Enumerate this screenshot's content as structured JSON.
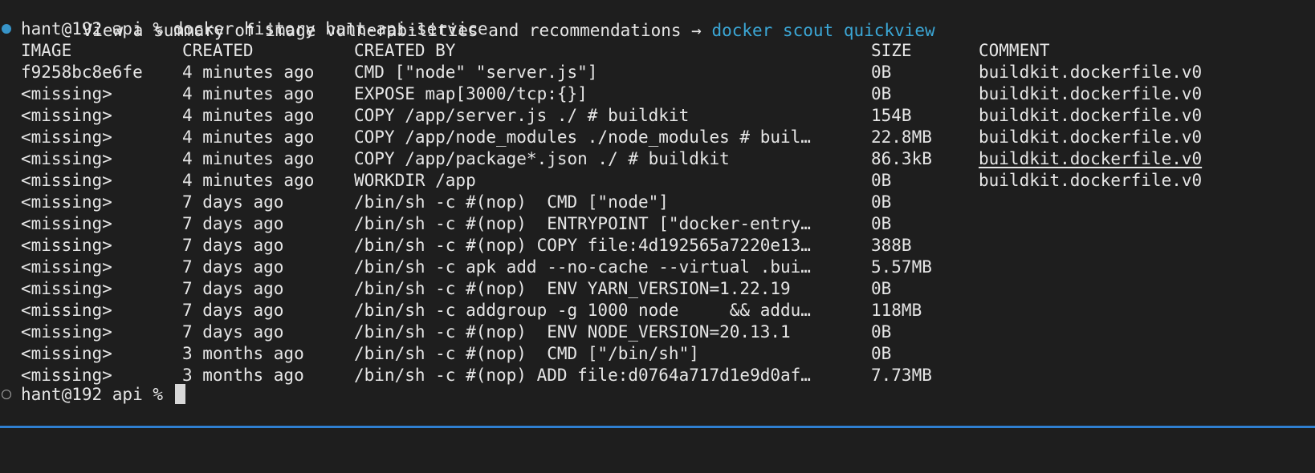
{
  "hint": {
    "text": "View a summary of image vulnerabilities and recommendations → ",
    "command": "docker scout quickview"
  },
  "prompt": {
    "text": "hant@192 api % ",
    "command": "docker history hant-api-service"
  },
  "table": {
    "headers": [
      "IMAGE",
      "CREATED",
      "CREATED BY",
      "SIZE",
      "COMMENT"
    ],
    "rows": [
      [
        "f9258bc8e6fe",
        "4 minutes ago",
        "CMD [\"node\" \"server.js\"]",
        "0B",
        "buildkit.dockerfile.v0"
      ],
      [
        "<missing>",
        "4 minutes ago",
        "EXPOSE map[3000/tcp:{}]",
        "0B",
        "buildkit.dockerfile.v0"
      ],
      [
        "<missing>",
        "4 minutes ago",
        "COPY /app/server.js ./ # buildkit",
        "154B",
        "buildkit.dockerfile.v0"
      ],
      [
        "<missing>",
        "4 minutes ago",
        "COPY /app/node_modules ./node_modules # buil…",
        "22.8MB",
        "buildkit.dockerfile.v0"
      ],
      [
        "<missing>",
        "4 minutes ago",
        "COPY /app/package*.json ./ # buildkit",
        "86.3kB",
        "buildkit.dockerfile.v0"
      ],
      [
        "<missing>",
        "4 minutes ago",
        "WORKDIR /app",
        "0B",
        "buildkit.dockerfile.v0"
      ],
      [
        "<missing>",
        "7 days ago",
        "/bin/sh -c #(nop)  CMD [\"node\"]",
        "0B",
        ""
      ],
      [
        "<missing>",
        "7 days ago",
        "/bin/sh -c #(nop)  ENTRYPOINT [\"docker-entry…",
        "0B",
        ""
      ],
      [
        "<missing>",
        "7 days ago",
        "/bin/sh -c #(nop) COPY file:4d192565a7220e13…",
        "388B",
        ""
      ],
      [
        "<missing>",
        "7 days ago",
        "/bin/sh -c apk add --no-cache --virtual .bui…",
        "5.57MB",
        ""
      ],
      [
        "<missing>",
        "7 days ago",
        "/bin/sh -c #(nop)  ENV YARN_VERSION=1.22.19",
        "0B",
        ""
      ],
      [
        "<missing>",
        "7 days ago",
        "/bin/sh -c addgroup -g 1000 node     && addu…",
        "118MB",
        ""
      ],
      [
        "<missing>",
        "7 days ago",
        "/bin/sh -c #(nop)  ENV NODE_VERSION=20.13.1",
        "0B",
        ""
      ],
      [
        "<missing>",
        "3 months ago",
        "/bin/sh -c #(nop)  CMD [\"/bin/sh\"]",
        "0B",
        ""
      ],
      [
        "<missing>",
        "3 months ago",
        "/bin/sh -c #(nop) ADD file:d0764a717d1e9d0af…",
        "7.73MB",
        ""
      ]
    ]
  },
  "final_prompt": {
    "text": "hant@192 api % "
  },
  "colors": {
    "background": "#1e1e1e",
    "text": "#e6e6e6",
    "link": "#3ba7d6",
    "dot_active": "#3794c8",
    "bottom_bar": "#2f7fd0"
  }
}
